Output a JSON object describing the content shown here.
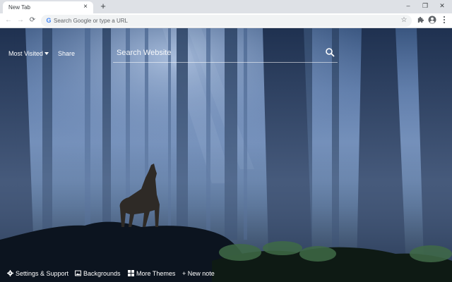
{
  "browser": {
    "tab_title": "New Tab",
    "tab_close_glyph": "×",
    "new_tab_glyph": "+",
    "window_controls": {
      "minimize": "–",
      "maximize": "❐",
      "close": "✕"
    },
    "nav": {
      "back": "←",
      "forward": "→",
      "reload": "⟳"
    },
    "omnibox_placeholder": "Search Google or type a URL",
    "omnibox_logo": "G",
    "icons": {
      "star": "star-icon",
      "extensions": "puzzle-icon",
      "profile": "profile-icon",
      "menu": "kebab-menu-icon"
    }
  },
  "newtab": {
    "most_visited_label": "Most Visited",
    "share_label": "Share",
    "search_placeholder": "Search Website",
    "bottom_bar": {
      "settings_label": "Settings & Support",
      "backgrounds_label": "Backgrounds",
      "themes_label": "More Themes",
      "new_note_label": "+ New note"
    },
    "background": "forest-wolf-howling",
    "colors": {
      "text": "#ffffff",
      "sky_top": "#3a5680",
      "mist": "#6b88b4",
      "ground": "#1d2c3d"
    }
  }
}
